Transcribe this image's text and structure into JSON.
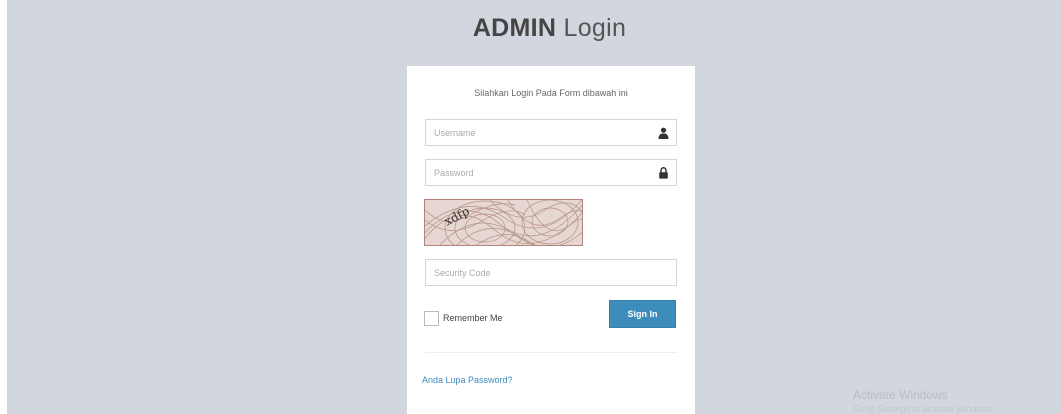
{
  "logo": {
    "bold": "ADMIN",
    "light": "Login"
  },
  "login_box": {
    "message": "Silahkan Login Pada Form dibawah ini",
    "username": {
      "placeholder": "Username",
      "icon": "user-icon"
    },
    "password": {
      "placeholder": "Password",
      "icon": "lock-icon"
    },
    "captcha": {
      "text": "xdfp"
    },
    "security_code": {
      "placeholder": "Security Code"
    },
    "remember_label": "Remember Me",
    "signin_label": "Sign In",
    "forgot_link": "Anda Lupa Password?"
  },
  "watermark": {
    "title": "Activate Windows",
    "subtitle": "Go to Settings to activate Windows."
  },
  "colors": {
    "background": "#d2d6de",
    "primary": "#3c8dbc",
    "box": "#ffffff"
  }
}
